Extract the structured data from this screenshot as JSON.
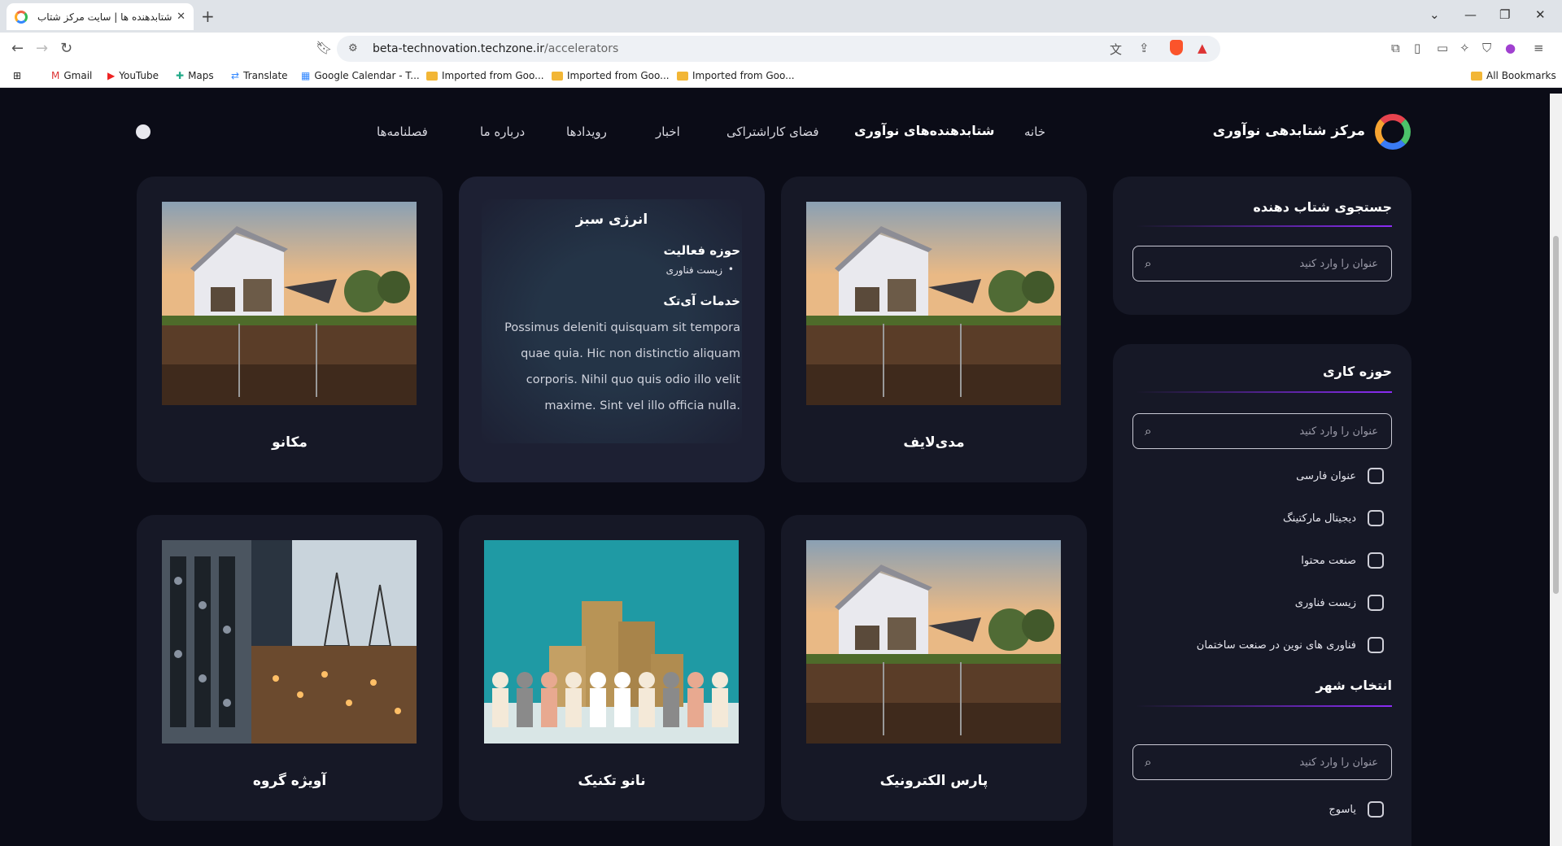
{
  "browser": {
    "tab_title": "شتابدهنده ها | سایت مرکز شتاب",
    "url_host": "beta-technovation.techzone.ir",
    "url_path": "/accelerators",
    "bookmarks": [
      {
        "label": "Gmail",
        "icon": "gmail-icon"
      },
      {
        "label": "YouTube",
        "icon": "youtube-icon"
      },
      {
        "label": "Maps",
        "icon": "maps-icon"
      },
      {
        "label": "Translate",
        "icon": "translate-icon"
      },
      {
        "label": "Google Calendar - T...",
        "icon": "calendar-icon"
      },
      {
        "label": "Imported from Goo...",
        "icon": "folder-icon"
      },
      {
        "label": "Imported from Goo...",
        "icon": "folder-icon"
      },
      {
        "label": "Imported from Goo...",
        "icon": "folder-icon"
      }
    ],
    "all_bookmarks": "All Bookmarks"
  },
  "site": {
    "logo_text": "مرکز شتابدهی نوآوری",
    "menu": [
      "خانه",
      "شتابدهنده‌های نوآوری",
      "فضای کاراشتراکی",
      "اخبار",
      "رویدادها",
      "درباره ما",
      "فصلنامه‌ها"
    ],
    "active_menu": "شتابدهنده‌های نوآوری"
  },
  "sidebar": {
    "search_title": "جستجوی شتاب دهنده",
    "placeholder": "عنوان را وارد کنید",
    "field_title": "حوزه کاری",
    "fields": [
      "عنوان فارسی",
      "دیجیتال مارکتینگ",
      "صنعت محتوا",
      "زیست فناوری",
      "فناوری های نوین در صنعت ساختمان"
    ],
    "city_title": "انتخاب شهر",
    "cities": [
      "یاسوج"
    ]
  },
  "cards": [
    {
      "title": "مدی‌لایف",
      "image": "house-image"
    },
    {
      "title": "انرژی سبز",
      "image": "overlay"
    },
    {
      "title": "مکانو",
      "image": "house-image"
    },
    {
      "title": "پارس الکترونیک",
      "image": "house-image"
    },
    {
      "title": "نانو تکنیک",
      "image": "coins-image"
    },
    {
      "title": "آویژه گروه",
      "image": "industry-image"
    }
  ],
  "overlay": {
    "title": "انرژی سبز",
    "field_heading": "حوزه فعالیت",
    "field_item": "زیست فناوری",
    "services_heading": "خدمات آی‌تک",
    "description": "Possimus deleniti quisquam sit tempora quae quia. Hic non distinctio aliquam corporis. Nihil quo quis odio illo velit maxime. Sint vel illo officia nulla."
  }
}
